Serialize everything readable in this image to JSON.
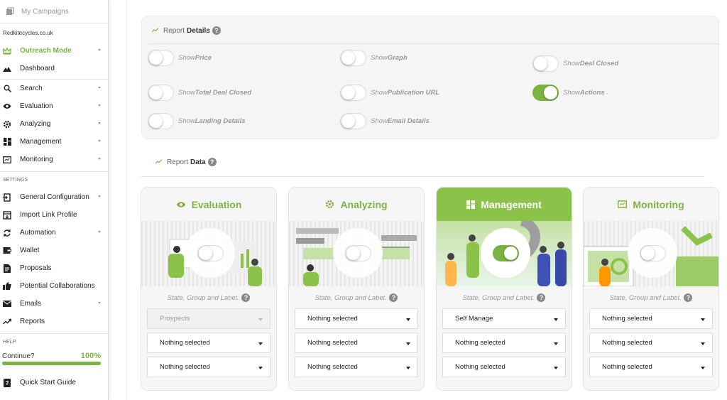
{
  "sidebar": {
    "top_item": "My Campaigns",
    "domain": "Redkitecycles.co.uk",
    "items": [
      {
        "label": "Outreach Mode",
        "icon": "crown-icon",
        "active": true,
        "chevron": true
      },
      {
        "label": "Dashboard",
        "icon": "mountain-icon",
        "chevron": false
      },
      {
        "label": "Search",
        "icon": "search-icon",
        "chevron": true
      },
      {
        "label": "Evaluation",
        "icon": "eye-icon",
        "chevron": true
      },
      {
        "label": "Analyzing",
        "icon": "gear-icon",
        "chevron": true
      },
      {
        "label": "Management",
        "icon": "grid-icon",
        "chevron": true
      },
      {
        "label": "Monitoring",
        "icon": "monitor-icon",
        "chevron": true
      }
    ],
    "settings_title": "SETTINGS",
    "settings_items": [
      {
        "label": "General Configuration",
        "icon": "config-icon",
        "chevron": true
      },
      {
        "label": "Import Link Profile",
        "icon": "import-icon",
        "chevron": false
      },
      {
        "label": "Automation",
        "icon": "sync-icon",
        "chevron": true
      },
      {
        "label": "Wallet",
        "icon": "wallet-icon",
        "chevron": false
      },
      {
        "label": "Proposals",
        "icon": "document-icon",
        "chevron": false
      },
      {
        "label": "Potential Collaborations",
        "icon": "thumbs-up-icon",
        "chevron": false
      },
      {
        "label": "Emails",
        "icon": "mail-icon",
        "chevron": true
      },
      {
        "label": "Reports",
        "icon": "trend-icon",
        "chevron": false
      }
    ],
    "help_title": "HELP",
    "help_continue": "Continue?",
    "help_percent": "100%",
    "help_progress": 1.0,
    "quick_start": "Quick Start Guide"
  },
  "report_details": {
    "title_prefix": "Report",
    "title_bold": "Details",
    "toggles": [
      {
        "pre": "Show ",
        "bold": "Price",
        "on": false
      },
      {
        "pre": "Show ",
        "bold": "Graph",
        "on": false
      },
      {
        "pre": "Show ",
        "bold": "Deal Closed",
        "on": false
      },
      {
        "pre": "Show ",
        "bold": "Total Deal Closed",
        "on": false
      },
      {
        "pre": "Show ",
        "bold": "Publication URL",
        "on": false
      },
      {
        "pre": "Show ",
        "bold": "Actions",
        "on": true
      },
      {
        "pre": "Show ",
        "bold": "Landing Details",
        "on": false
      },
      {
        "pre": "Show ",
        "bold": "Email Details",
        "on": false
      }
    ]
  },
  "report_data": {
    "title_prefix": "Report",
    "title_bold": "Data",
    "cards": [
      {
        "title": "Evaluation",
        "icon": "eye-icon",
        "active": false,
        "toggle_on": false,
        "sgl": "State, Group and Label.",
        "dropdowns": [
          {
            "value": "Prospects",
            "disabled": true
          },
          {
            "value": "Nothing selected"
          },
          {
            "value": "Nothing selected"
          }
        ]
      },
      {
        "title": "Analyzing",
        "icon": "gear-icon",
        "active": false,
        "toggle_on": false,
        "sgl": "State, Group and Label.",
        "dropdowns": [
          {
            "value": "Nothing selected"
          },
          {
            "value": "Nothing selected"
          },
          {
            "value": "Nothing selected"
          }
        ]
      },
      {
        "title": "Management",
        "icon": "grid-icon",
        "active": true,
        "toggle_on": true,
        "sgl": "State, Group and Label.",
        "dropdowns": [
          {
            "value": "Self Manage"
          },
          {
            "value": "Nothing selected"
          },
          {
            "value": "Nothing selected"
          }
        ]
      },
      {
        "title": "Monitoring",
        "icon": "monitor-icon",
        "active": false,
        "toggle_on": false,
        "sgl": "State, Group and Label.",
        "dropdowns": [
          {
            "value": "Nothing selected"
          },
          {
            "value": "Nothing selected"
          },
          {
            "value": "Nothing selected"
          }
        ]
      }
    ]
  },
  "colors": {
    "accent": "#7cb342",
    "card_active": "#8bc34a"
  }
}
